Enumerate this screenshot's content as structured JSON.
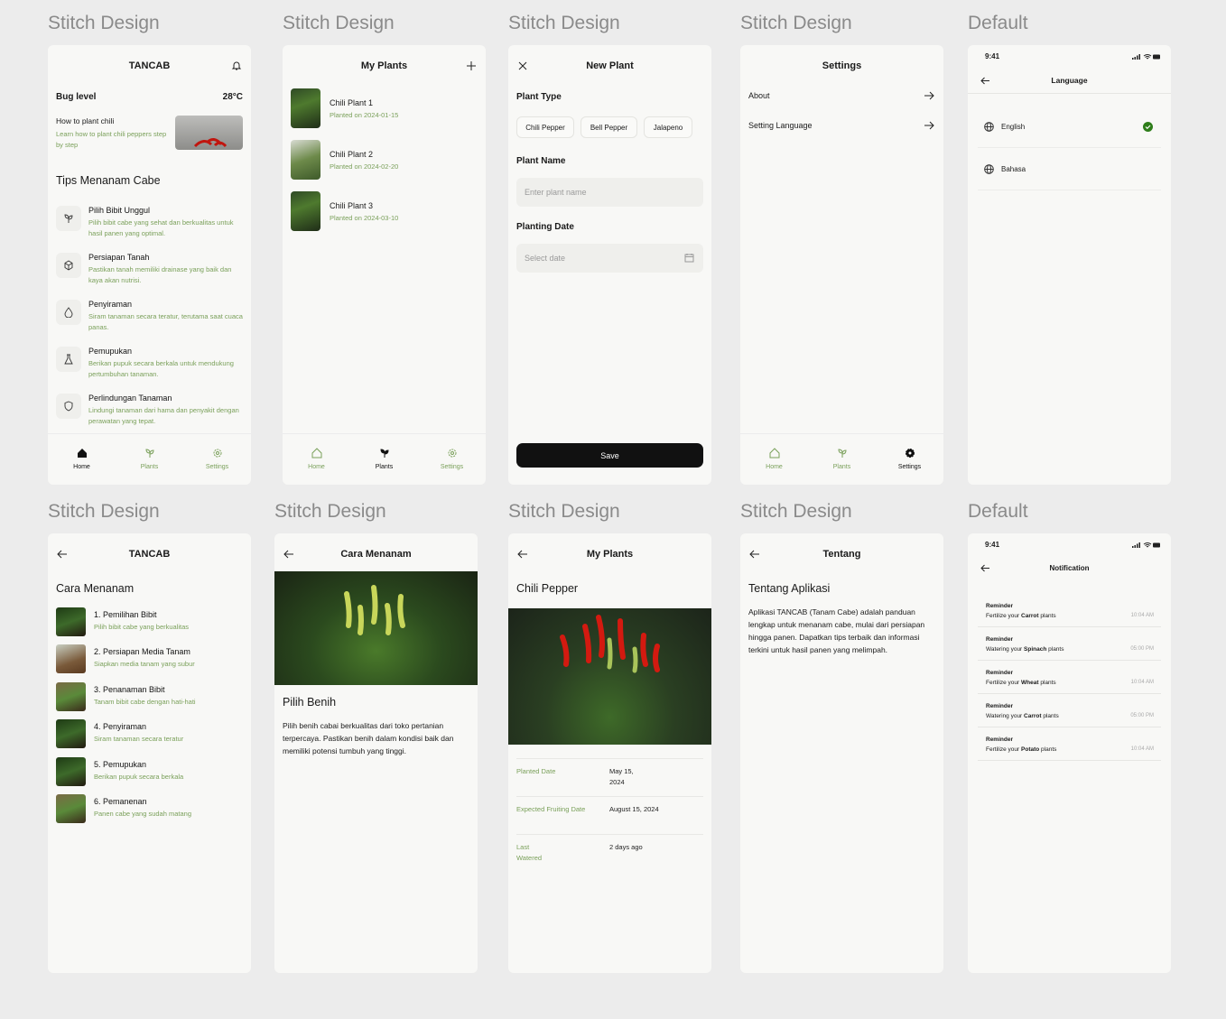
{
  "labels": [
    "Stitch Design",
    "Stitch Design",
    "Stitch Design",
    "Stitch Design",
    "Default",
    "Stitch Design",
    "Stitch Design",
    "Stitch Design",
    "Stitch Design",
    "Default"
  ],
  "home": {
    "app": "TANCAB",
    "bug": "Bug level",
    "temp": "28°C",
    "how_title": "How to plant chili",
    "how_desc": "Learn how to plant chili peppers step by step",
    "section": "Tips Menanam Cabe",
    "tips": [
      {
        "t": "Pilih Bibit Unggul",
        "d": "Pilih bibit cabe yang sehat dan berkualitas untuk hasil panen yang optimal."
      },
      {
        "t": "Persiapan Tanah",
        "d": "Pastikan tanah memiliki drainase yang baik dan kaya akan nutrisi."
      },
      {
        "t": "Penyiraman",
        "d": "Siram tanaman secara teratur, terutama saat cuaca panas."
      },
      {
        "t": "Pemupukan",
        "d": "Berikan pupuk secara berkala untuk mendukung pertumbuhan tanaman."
      },
      {
        "t": "Perlindungan Tanaman",
        "d": "Lindungi tanaman dari hama dan penyakit dengan perawatan yang tepat."
      }
    ]
  },
  "nav": {
    "home": "Home",
    "plants": "Plants",
    "settings": "Settings"
  },
  "myplants": {
    "title": "My Plants",
    "items": [
      {
        "n": "Chili Plant 1",
        "d": "Planted on 2024-01-15"
      },
      {
        "n": "Chili Plant 2",
        "d": "Planted on 2024-02-20"
      },
      {
        "n": "Chili Plant 3",
        "d": "Planted on 2024-03-10"
      }
    ]
  },
  "newplant": {
    "title": "New Plant",
    "type_label": "Plant Type",
    "types": [
      "Chili Pepper",
      "Bell Pepper",
      "Jalapeno"
    ],
    "name_label": "Plant Name",
    "name_ph": "Enter plant name",
    "date_label": "Planting Date",
    "date_ph": "Select date",
    "save": "Save"
  },
  "settings": {
    "title": "Settings",
    "about": "About",
    "lang": "Setting Language"
  },
  "language": {
    "time": "9:41",
    "title": "Language",
    "opts": [
      "English",
      "Bahasa"
    ]
  },
  "cara": {
    "app": "TANCAB",
    "title": "Cara Menanam",
    "steps": [
      {
        "t": "1. Pemilihan Bibit",
        "d": "Pilih bibit cabe yang berkualitas"
      },
      {
        "t": "2. Persiapan Media Tanam",
        "d": "Siapkan media tanam yang subur"
      },
      {
        "t": "3. Penanaman Bibit",
        "d": "Tanam bibit cabe dengan hati-hati"
      },
      {
        "t": "4. Penyiraman",
        "d": "Siram tanaman secara teratur"
      },
      {
        "t": "5. Pemupukan",
        "d": "Berikan pupuk secara berkala"
      },
      {
        "t": "6. Pemanenan",
        "d": "Panen cabe yang sudah matang"
      }
    ]
  },
  "benih": {
    "title": "Cara Menanam",
    "heading": "Pilih Benih",
    "body": "Pilih benih cabai berkualitas dari toko pertanian terpercaya. Pastikan benih dalam kondisi baik dan memiliki potensi tumbuh yang tinggi."
  },
  "detail": {
    "title": "My Plants",
    "heading": "Chili Pepper",
    "rows": [
      {
        "k": "Planted Date",
        "v": "May 15, 2024"
      },
      {
        "k": "Expected Fruiting Date",
        "v": "August 15, 2024"
      },
      {
        "k": "Last Watered",
        "v": "2 days ago"
      }
    ]
  },
  "tentang": {
    "title": "Tentang",
    "heading": "Tentang Aplikasi",
    "body": "Aplikasi TANCAB (Tanam Cabe) adalah panduan lengkap untuk menanam cabe, mulai dari persiapan hingga panen. Dapatkan tips terbaik dan informasi terkini untuk hasil panen yang melimpah."
  },
  "notif": {
    "time": "9:41",
    "title": "Notification",
    "items": [
      {
        "a": "Reminder",
        "pre": "Fertilize your ",
        "b": "Carrot",
        "post": " plants",
        "c": "10:04 AM"
      },
      {
        "a": "Reminder",
        "pre": "Watering your ",
        "b": "Spinach",
        "post": " plants",
        "c": "05:00 PM"
      },
      {
        "a": "Reminder",
        "pre": "Fertilize your ",
        "b": "Wheat",
        "post": " plants",
        "c": "10:04 AM"
      },
      {
        "a": "Reminder",
        "pre": "Watering your ",
        "b": "Carrot",
        "post": " plants",
        "c": "05:00 PM"
      },
      {
        "a": "Reminder",
        "pre": "Fertilize your ",
        "b": "Potato",
        "post": " plants",
        "c": "10:04 AM"
      }
    ]
  }
}
